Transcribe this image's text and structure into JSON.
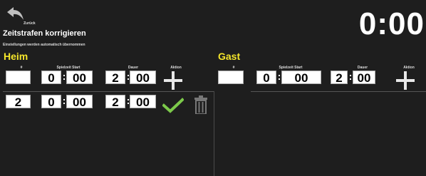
{
  "header": {
    "back_label": "Zurück",
    "title": "Zeitstrafen korrigieren",
    "subtitle": "Einstellungen werden automatisch übernommen",
    "clock": "0:00"
  },
  "home": {
    "team_label": "Heim",
    "columns": {
      "number": "#",
      "start": "Spielzeit Start",
      "duration": "Dauer",
      "action": "Aktion"
    },
    "new_entry": {
      "number": "",
      "start_min": "0",
      "start_sec": "00",
      "dur_min": "2",
      "dur_sec": "00"
    },
    "penalties": [
      {
        "number": "2",
        "start_min": "0",
        "start_sec": "00",
        "dur_min": "2",
        "dur_sec": "00"
      }
    ]
  },
  "guest": {
    "team_label": "Gast",
    "columns": {
      "number": "#",
      "start": "Spielzeit Start",
      "duration": "Dauer",
      "action": "Aktion"
    },
    "new_entry": {
      "number": "",
      "start_min": "0",
      "start_sec": "00",
      "dur_min": "2",
      "dur_sec": "00"
    }
  },
  "colors": {
    "team_label": "#f5e62b",
    "confirm": "#7cc94a",
    "delete": "#777777",
    "background": "#1e1e1e"
  }
}
